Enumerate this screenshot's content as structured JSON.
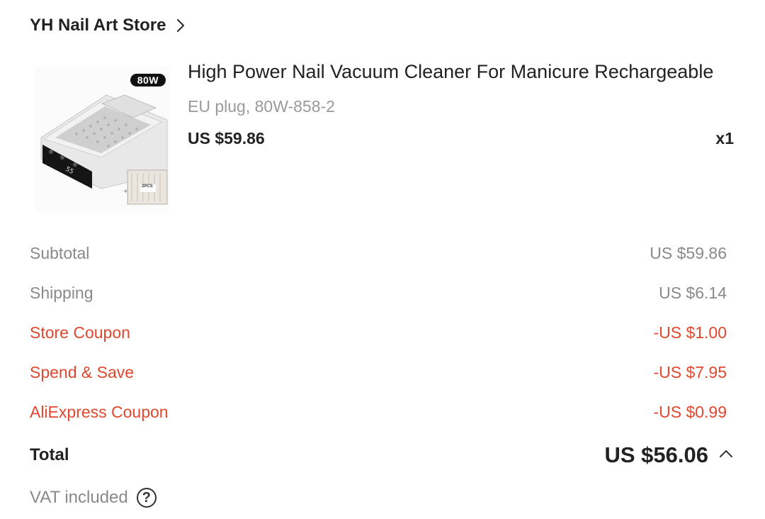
{
  "store": {
    "name": "YH Nail Art Store"
  },
  "product": {
    "title": "High Power Nail Vacuum Cleaner For Manicure Rechargeable",
    "variant": "EU plug, 80W-858-2",
    "price": "US $59.86",
    "quantity": "x1",
    "image_badge": "80W",
    "image_extra_label": "2PCS"
  },
  "summary": {
    "rows": [
      {
        "label": "Subtotal",
        "value": "US $59.86",
        "style": "muted"
      },
      {
        "label": "Shipping",
        "value": "US $6.14",
        "style": "muted"
      },
      {
        "label": "Store Coupon",
        "value": "-US $1.00",
        "style": "red"
      },
      {
        "label": "Spend & Save",
        "value": "-US $7.95",
        "style": "red"
      },
      {
        "label": "AliExpress Coupon",
        "value": "-US $0.99",
        "style": "red"
      }
    ],
    "total_label": "Total",
    "total_value": "US $56.06",
    "vat_label": "VAT included",
    "help_glyph": "?"
  },
  "colors": {
    "discount_red": "#e2472f",
    "muted_gray": "#8a8a8a",
    "text": "#222222"
  },
  "icons": [
    "chevron-right-icon",
    "chevron-up-icon",
    "help-circle-icon"
  ]
}
